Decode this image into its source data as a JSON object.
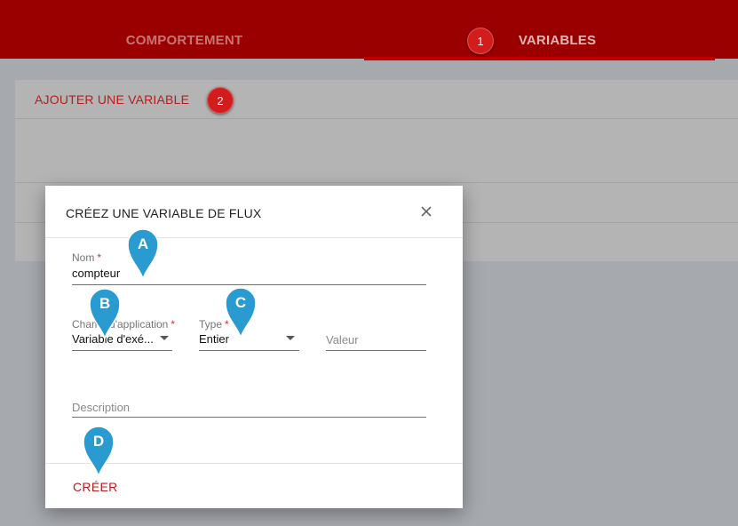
{
  "tabs": [
    {
      "label": "COMPORTEMENT"
    },
    {
      "label": "VARIABLES",
      "step": "1"
    }
  ],
  "panel": {
    "add_variable_label": "AJOUTER UNE VARIABLE",
    "step": "2"
  },
  "dialog": {
    "title": "CRÉEZ UNE VARIABLE DE FLUX",
    "close_icon": "close-icon",
    "fields": {
      "name": {
        "label": "Nom",
        "required": "*",
        "value": "compteur"
      },
      "scope": {
        "label": "Champ d'application",
        "required": "*",
        "value": "Variable d'exé..."
      },
      "type": {
        "label": "Type",
        "required": "*",
        "value": "Entier"
      },
      "value": {
        "placeholder": "Valeur"
      },
      "description": {
        "placeholder": "Description"
      }
    },
    "create_label": "CRÉER"
  },
  "callouts": [
    "A",
    "B",
    "C",
    "D"
  ],
  "colors": {
    "header": "#9a0000",
    "accent": "#b41e1e",
    "step_badge": "#d31d1d",
    "callout": "#2a9bd0"
  }
}
